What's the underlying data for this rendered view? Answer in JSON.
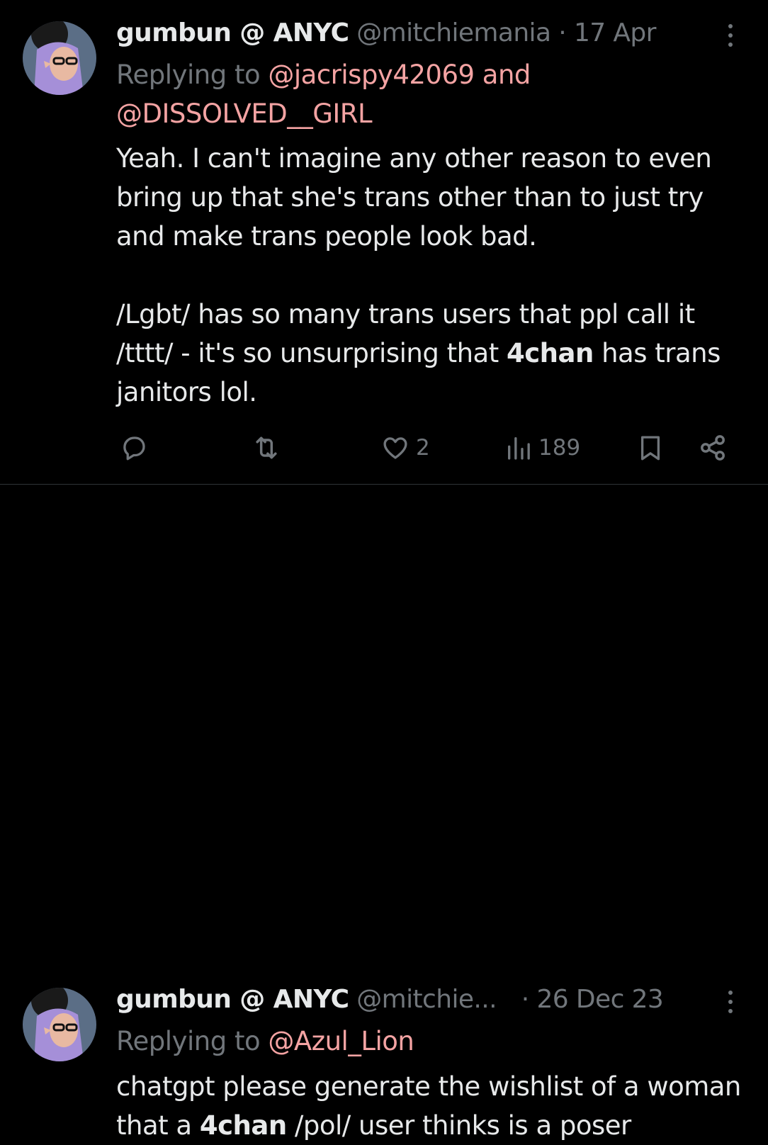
{
  "tweets": [
    {
      "display_name": "gumbun @ ANYC",
      "handle": "@mitchiemania",
      "separator": "·",
      "time": "17 Apr",
      "reply_prefix": "Replying to",
      "reply_mentions": [
        "@jacrispy42069",
        "@DISSOLVED__GIRL"
      ],
      "reply_conjunction": "and",
      "body": {
        "p1": "Yeah. I can't imagine any other reason to even bring up that she's trans other than to just try and make trans people look bad.",
        "p2_before": "/Lgbt/ has so many trans users that ppl call it /tttt/ - it's so unsurprising that ",
        "p2_bold": "4chan",
        "p2_after": " has trans janitors lol."
      },
      "actions": {
        "reply_icon": "speech-bubble-icon",
        "retweet_icon": "retweet-icon",
        "like_icon": "heart-icon",
        "like_count": "2",
        "views_icon": "bar-chart-icon",
        "views_count": "189",
        "bookmark_icon": "bookmark-icon",
        "share_icon": "share-icon"
      }
    },
    {
      "display_name": "gumbun @ ANYC",
      "handle": "@mitchie...",
      "separator": "·",
      "time": "26 Dec 23",
      "reply_prefix": "Replying to",
      "reply_mentions": [
        "@Azul_Lion"
      ],
      "body": {
        "before": "chatgpt please generate the wishlist of a woman that a ",
        "bold": "4chan",
        "after": " /pol/ user thinks is a poser"
      }
    }
  ],
  "colors": {
    "background": "#000000",
    "text": "#e7e9ea",
    "muted": "#71767b",
    "mention": "#f4a3a3",
    "divider": "#2f3336"
  }
}
